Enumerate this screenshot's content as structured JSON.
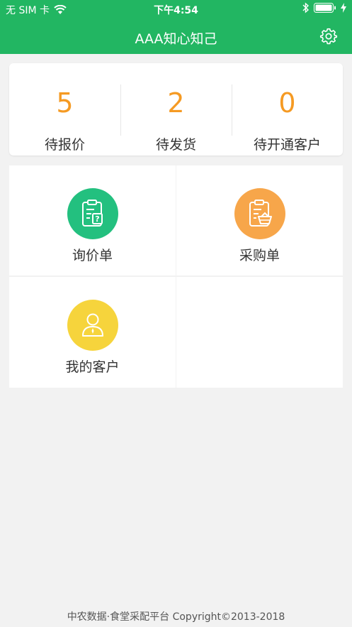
{
  "status": {
    "carrier": "无 SIM 卡",
    "time": "下午4:54"
  },
  "nav": {
    "title": "AAA知心知己"
  },
  "stats": [
    {
      "value": "5",
      "label": "待报价"
    },
    {
      "value": "2",
      "label": "待发货"
    },
    {
      "value": "0",
      "label": "待开通客户"
    }
  ],
  "menu": [
    {
      "label": "询价单",
      "color": "#23c07f",
      "icon": "inquiry-clipboard-icon"
    },
    {
      "label": "采购单",
      "color": "#f7a64a",
      "icon": "purchase-basket-icon"
    },
    {
      "label": "我的客户",
      "color": "#f6d43c",
      "icon": "user-icon"
    }
  ],
  "colors": {
    "brand": "#22b662",
    "accent": "#f59a23"
  },
  "footer": "中农数据·食堂采配平台 Copyright©2013-2018"
}
